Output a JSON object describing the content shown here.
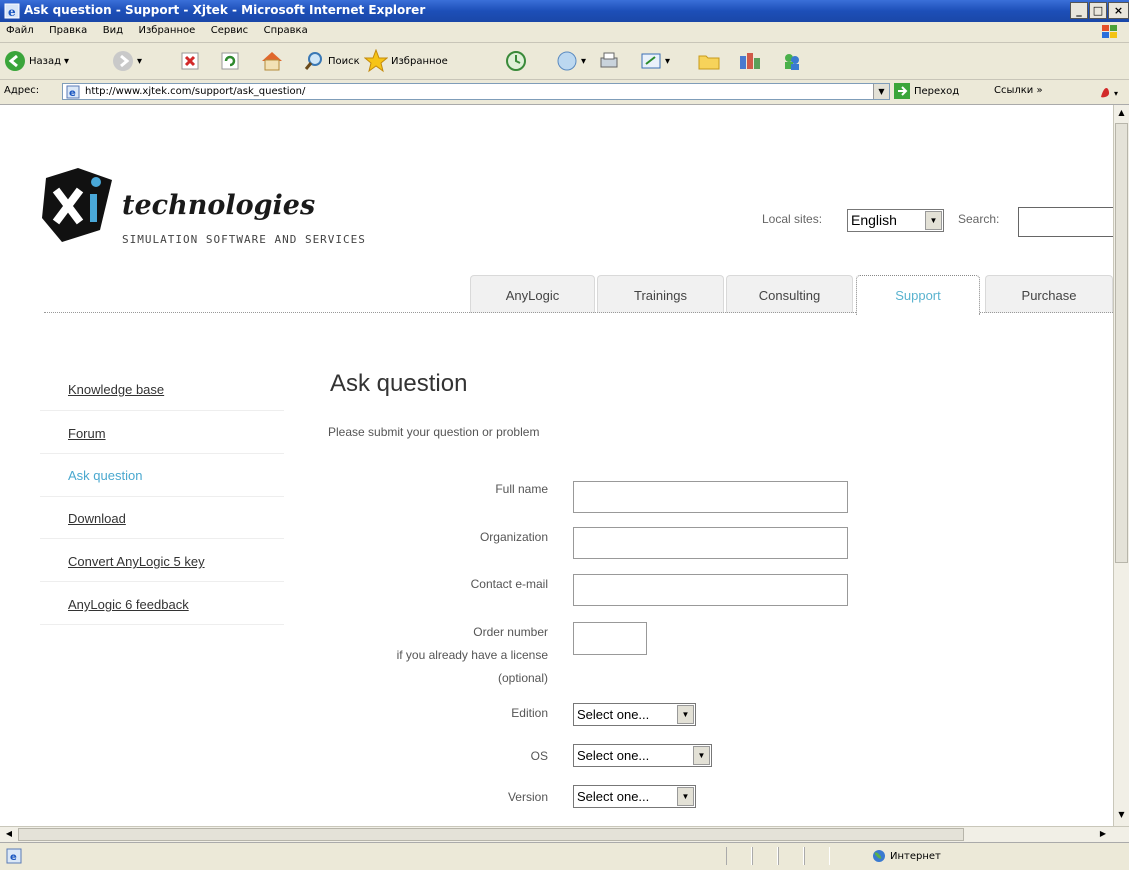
{
  "window": {
    "title": "Ask question - Support - Xjtek - Microsoft Internet Explorer",
    "controls": {
      "minimize": "_",
      "maximize": "□",
      "close": "×"
    }
  },
  "menu": [
    "Файл",
    "Правка",
    "Вид",
    "Избранное",
    "Сервис",
    "Справка"
  ],
  "toolbar": {
    "back": "Назад",
    "search": "Поиск",
    "favorites": "Избранное"
  },
  "address": {
    "label": "Адрес:",
    "url": "http://www.xjtek.com/support/ask_question/",
    "go": "Переход",
    "links": "Ссылки"
  },
  "site": {
    "logo_text": "technologies",
    "tagline": "SIMULATION SOFTWARE AND SERVICES",
    "local_sites_label": "Local sites:",
    "local_sites_value": "English",
    "search_label": "Search:"
  },
  "tabs": [
    {
      "label": "AnyLogic"
    },
    {
      "label": "Trainings"
    },
    {
      "label": "Consulting"
    },
    {
      "label": "Support"
    },
    {
      "label": "Purchase"
    }
  ],
  "sidebar": [
    {
      "label": "Knowledge base"
    },
    {
      "label": "Forum"
    },
    {
      "label": "Ask question"
    },
    {
      "label": "Download"
    },
    {
      "label": "Convert AnyLogic 5 key"
    },
    {
      "label": "AnyLogic 6 feedback"
    }
  ],
  "main": {
    "heading": "Ask question",
    "intro": "Please submit your question or problem",
    "fields": {
      "full_name": "Full name",
      "organization": "Organization",
      "email": "Contact e-mail",
      "order_number": "Order number",
      "order_hint1": "if you already have a license",
      "order_hint2": "(optional)",
      "edition": "Edition",
      "os": "OS",
      "version": "Version"
    },
    "select_placeholder": "Select one..."
  },
  "status": {
    "zone": "Интернет"
  },
  "colors": {
    "active_tab": "#5ab3cf",
    "titlebar": "#1d4fb8"
  }
}
